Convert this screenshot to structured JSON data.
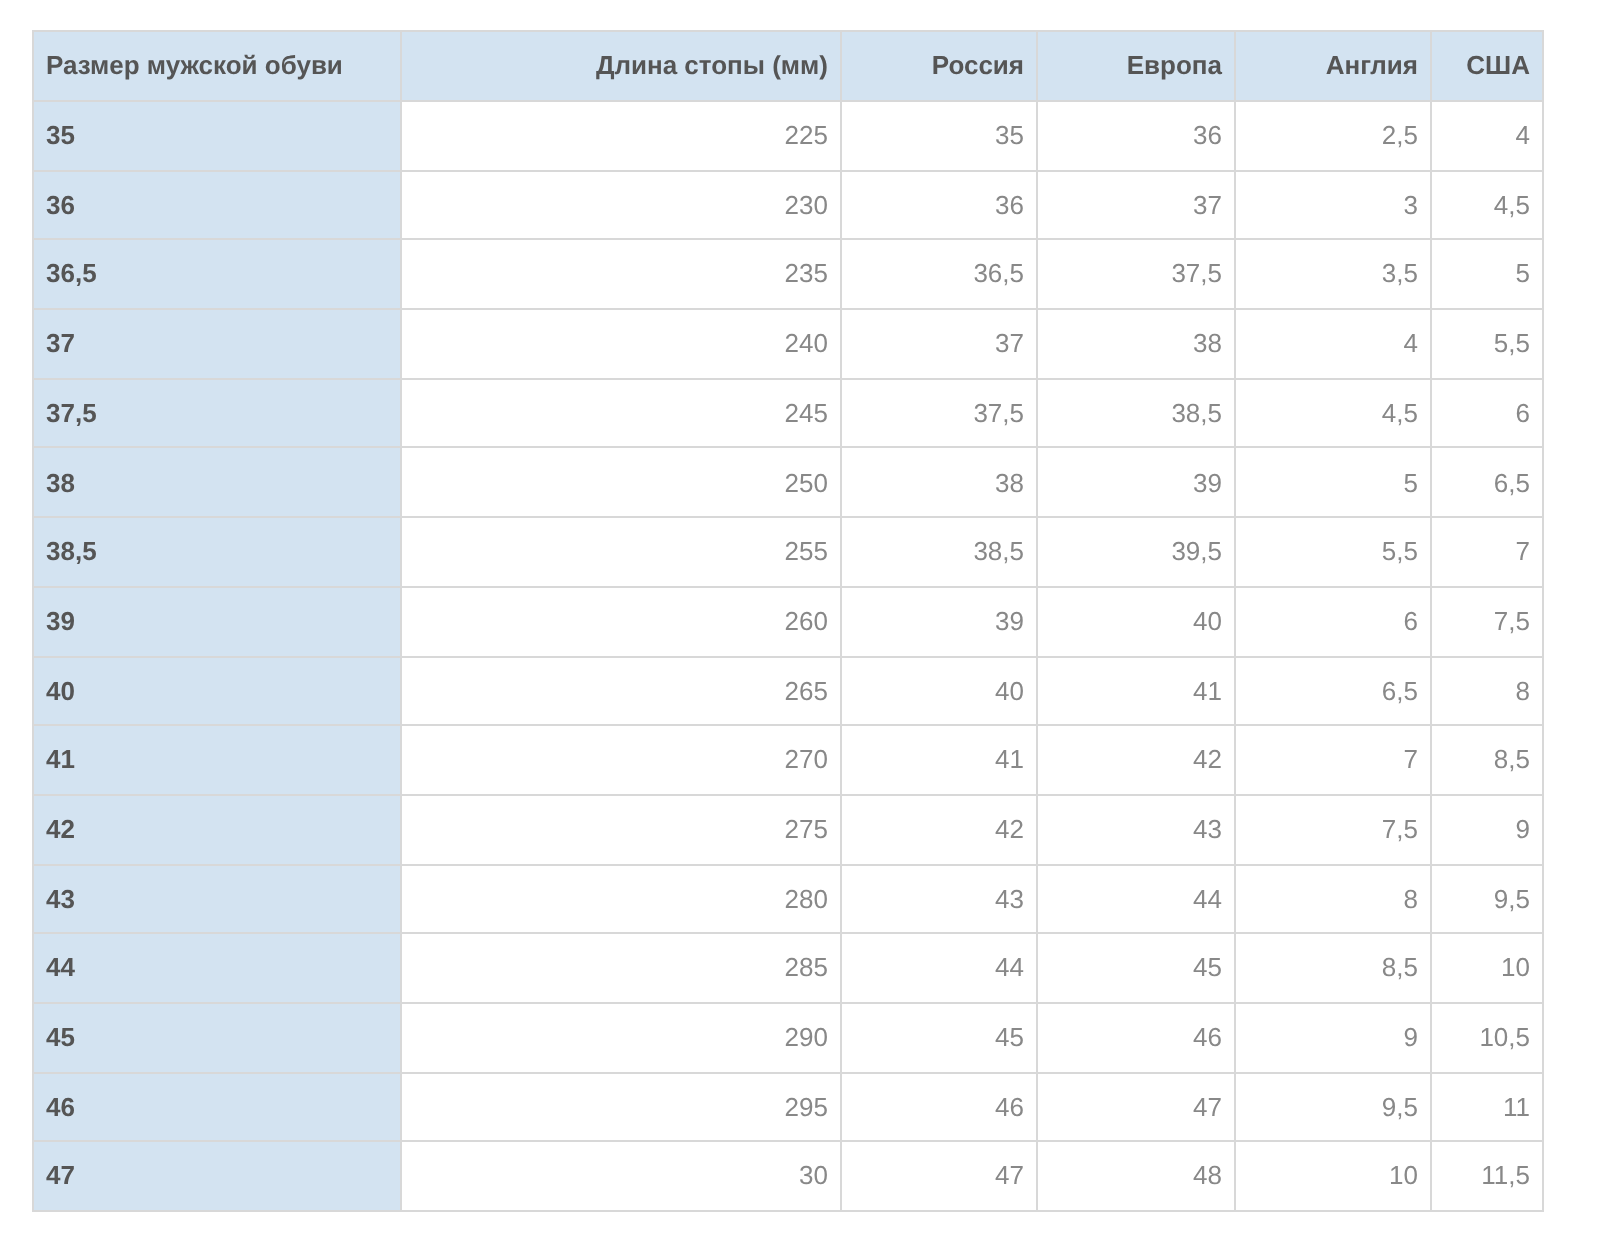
{
  "table": {
    "columns": [
      "Размер мужской обуви",
      "Длина стопы (мм)",
      "Россия",
      "Европа",
      "Англия",
      "США"
    ],
    "rows": [
      [
        "35",
        "225",
        "35",
        "36",
        "2,5",
        "4"
      ],
      [
        "36",
        "230",
        "36",
        "37",
        "3",
        "4,5"
      ],
      [
        "36,5",
        "235",
        "36,5",
        "37,5",
        "3,5",
        "5"
      ],
      [
        "37",
        "240",
        "37",
        "38",
        "4",
        "5,5"
      ],
      [
        "37,5",
        "245",
        "37,5",
        "38,5",
        "4,5",
        "6"
      ],
      [
        "38",
        "250",
        "38",
        "39",
        "5",
        "6,5"
      ],
      [
        "38,5",
        "255",
        "38,5",
        "39,5",
        "5,5",
        "7"
      ],
      [
        "39",
        "260",
        "39",
        "40",
        "6",
        "7,5"
      ],
      [
        "40",
        "265",
        "40",
        "41",
        "6,5",
        "8"
      ],
      [
        "41",
        "270",
        "41",
        "42",
        "7",
        "8,5"
      ],
      [
        "42",
        "275",
        "42",
        "43",
        "7,5",
        "9"
      ],
      [
        "43",
        "280",
        "43",
        "44",
        "8",
        "9,5"
      ],
      [
        "44",
        "285",
        "44",
        "45",
        "8,5",
        "10"
      ],
      [
        "45",
        "290",
        "45",
        "46",
        "9",
        "10,5"
      ],
      [
        "46",
        "295",
        "46",
        "47",
        "9,5",
        "11"
      ],
      [
        "47",
        "30",
        "47",
        "48",
        "10",
        "11,5"
      ]
    ]
  }
}
